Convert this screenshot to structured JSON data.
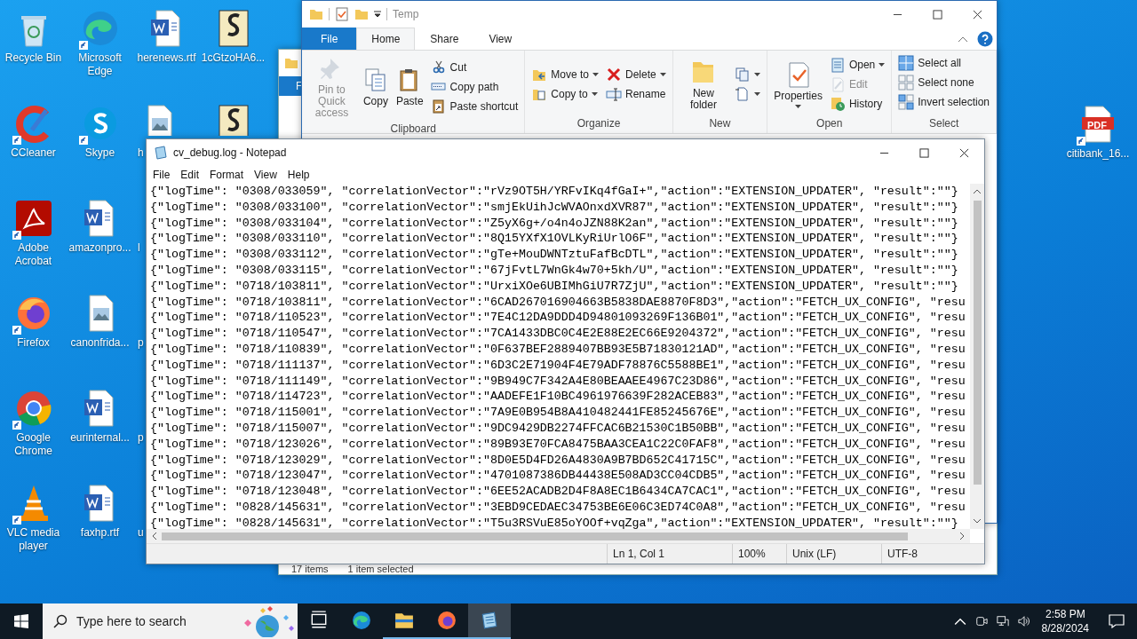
{
  "desktop": {
    "columns": [
      [
        {
          "kind": "recycle",
          "label": "Recycle Bin",
          "shortcut": false
        },
        {
          "kind": "ccleaner",
          "label": "CCleaner",
          "shortcut": true
        },
        {
          "kind": "acrobat",
          "label": "Adobe Acrobat",
          "shortcut": true
        },
        {
          "kind": "firefox",
          "label": "Firefox",
          "shortcut": true
        },
        {
          "kind": "chrome",
          "label": "Google Chrome",
          "shortcut": true
        },
        {
          "kind": "vlc",
          "label": "VLC media player",
          "shortcut": true
        }
      ],
      [
        {
          "kind": "edge",
          "label": "Microsoft Edge",
          "shortcut": true
        },
        {
          "kind": "skype",
          "label": "Skype",
          "shortcut": true
        },
        {
          "kind": "word",
          "label": "amazonpro...",
          "shortcut": false
        },
        {
          "kind": "image",
          "label": "canonfrida...",
          "shortcut": false
        },
        {
          "kind": "word",
          "label": "eurinternal...",
          "shortcut": false
        },
        {
          "kind": "word",
          "label": "faxhp.rtf",
          "shortcut": false
        }
      ],
      [
        {
          "kind": "word",
          "label": "herenews.rtf",
          "shortcut": false
        },
        {
          "kind": "image-cut",
          "label": "h",
          "shortcut": false
        },
        {
          "kind": "hidden",
          "label": "l"
        },
        {
          "kind": "hidden",
          "label": "p"
        },
        {
          "kind": "hidden",
          "label": "p"
        },
        {
          "kind": "hidden",
          "label": "u"
        }
      ],
      [
        {
          "kind": "script",
          "label": "1cGtzoHA6...",
          "shortcut": false
        },
        {
          "kind": "script-cut",
          "shortcut": false
        }
      ]
    ],
    "right_icons": [
      {
        "kind": "pdf",
        "label": "citibank_16...",
        "badge": "PDF",
        "shortcut": true
      }
    ]
  },
  "back_window": {
    "tab": "F",
    "status": [
      "17 items",
      "1 item selected"
    ]
  },
  "explorer": {
    "title": "Temp",
    "tabs": [
      {
        "label": "File",
        "kind": "file",
        "selected": false
      },
      {
        "label": "Home",
        "kind": "tab",
        "selected": true
      },
      {
        "label": "Share",
        "kind": "tab",
        "selected": false
      },
      {
        "label": "View",
        "kind": "tab",
        "selected": false
      }
    ],
    "groups": [
      {
        "name": "Clipboard",
        "columns": [
          [
            {
              "label": "Pin to Quick access",
              "kind": "pin",
              "disabled": true,
              "dropdown": false
            }
          ],
          [
            {
              "label": "Copy",
              "kind": "copy",
              "disabled": false,
              "dropdown": false
            }
          ],
          [
            {
              "label": "Paste",
              "kind": "paste",
              "disabled": false,
              "dropdown": false
            }
          ],
          [
            {
              "label": "Cut",
              "kind": "cut",
              "disabled": false,
              "dropdown": false
            },
            {
              "label": "Copy path",
              "kind": "copypath",
              "disabled": false,
              "dropdown": false
            },
            {
              "label": "Paste shortcut",
              "kind": "pasteshortcut",
              "disabled": false,
              "dropdown": false
            }
          ]
        ]
      },
      {
        "name": "Organize",
        "columns": [
          [
            {
              "label": "Move to",
              "kind": "move",
              "disabled": false,
              "dropdown": true
            },
            {
              "label": "Copy to",
              "kind": "copyto",
              "disabled": false,
              "dropdown": true
            }
          ],
          [
            {
              "label": "Delete",
              "kind": "delete",
              "disabled": false,
              "dropdown": true
            },
            {
              "label": "Rename",
              "kind": "rename",
              "disabled": false,
              "dropdown": false
            }
          ]
        ]
      },
      {
        "name": "New",
        "columns": [
          [
            {
              "label": "New folder",
              "kind": "folder",
              "disabled": false,
              "dropdown": false
            }
          ],
          [
            {
              "kind": "newitem",
              "disabled": false,
              "dropdown": true
            },
            {
              "kind": "easyaccess",
              "disabled": false,
              "dropdown": true
            }
          ]
        ]
      },
      {
        "name": "Open",
        "columns": [
          [
            {
              "label": "Properties",
              "kind": "properties",
              "disabled": false,
              "dropdown": true
            }
          ],
          [
            {
              "label": "Open",
              "kind": "open",
              "disabled": false,
              "dropdown": true
            },
            {
              "label": "Edit",
              "kind": "edit",
              "disabled": true,
              "dropdown": false
            },
            {
              "label": "History",
              "kind": "history",
              "disabled": false,
              "dropdown": false
            }
          ]
        ]
      },
      {
        "name": "Select",
        "columns": [
          [
            {
              "label": "Select all",
              "kind": "selall",
              "disabled": false,
              "dropdown": false
            },
            {
              "label": "Select none",
              "kind": "selnone",
              "disabled": false,
              "dropdown": false
            },
            {
              "label": "Invert selection",
              "kind": "invert",
              "disabled": false,
              "dropdown": false
            }
          ]
        ]
      }
    ]
  },
  "notepad": {
    "title": "cv_debug.log - Notepad",
    "menu": [
      "File",
      "Edit",
      "Format",
      "View",
      "Help"
    ],
    "lines": [
      "{\"logTime\": \"0308/033059\", \"correlationVector\":\"rVz9OT5H/YRFvIKq4fGaI+\",\"action\":\"EXTENSION_UPDATER\", \"result\":\"\"}",
      "{\"logTime\": \"0308/033100\", \"correlationVector\":\"smjEkUihJcWVAOnxdXVR87\",\"action\":\"EXTENSION_UPDATER\", \"result\":\"\"}",
      "{\"logTime\": \"0308/033104\", \"correlationVector\":\"Z5yX6g+/o4n4oJZN88K2an\",\"action\":\"EXTENSION_UPDATER\", \"result\":\"\"}",
      "{\"logTime\": \"0308/033110\", \"correlationVector\":\"8Q15YXfX1OVLKyRiUrlO6F\",\"action\":\"EXTENSION_UPDATER\", \"result\":\"\"}",
      "{\"logTime\": \"0308/033112\", \"correlationVector\":\"gTe+MouDWNTztuFafBcDTL\",\"action\":\"EXTENSION_UPDATER\", \"result\":\"\"}",
      "{\"logTime\": \"0308/033115\", \"correlationVector\":\"67jFvtL7WnGk4w70+5kh/U\",\"action\":\"EXTENSION_UPDATER\", \"result\":\"\"}",
      "{\"logTime\": \"0718/103811\", \"correlationVector\":\"UrxiXOe6UBIMhGiU7R7ZjU\",\"action\":\"EXTENSION_UPDATER\", \"result\":\"\"}",
      "{\"logTime\": \"0718/103811\", \"correlationVector\":\"6CAD267016904663B5838DAE8870F8D3\",\"action\":\"FETCH_UX_CONFIG\", \"resu",
      "{\"logTime\": \"0718/110523\", \"correlationVector\":\"7E4C12DA9DDD4D94801093269F136B01\",\"action\":\"FETCH_UX_CONFIG\", \"resu",
      "{\"logTime\": \"0718/110547\", \"correlationVector\":\"7CA1433DBC0C4E2E88E2EC66E9204372\",\"action\":\"FETCH_UX_CONFIG\", \"resu",
      "{\"logTime\": \"0718/110839\", \"correlationVector\":\"0F637BEF2889407BB93E5B71830121AD\",\"action\":\"FETCH_UX_CONFIG\", \"resu",
      "{\"logTime\": \"0718/111137\", \"correlationVector\":\"6D3C2E71904F4E79ADF78876C5588BE1\",\"action\":\"FETCH_UX_CONFIG\", \"resu",
      "{\"logTime\": \"0718/111149\", \"correlationVector\":\"9B949C7F342A4E80BEAAEE4967C23D86\",\"action\":\"FETCH_UX_CONFIG\", \"resu",
      "{\"logTime\": \"0718/114723\", \"correlationVector\":\"AADEFE1F10BC4961976639F282ACEB83\",\"action\":\"FETCH_UX_CONFIG\", \"resu",
      "{\"logTime\": \"0718/115001\", \"correlationVector\":\"7A9E0B954B8A410482441FE85245676E\",\"action\":\"FETCH_UX_CONFIG\", \"resu",
      "{\"logTime\": \"0718/115007\", \"correlationVector\":\"9DC9429DB2274FFCAC6B21530C1B50BB\",\"action\":\"FETCH_UX_CONFIG\", \"resu",
      "{\"logTime\": \"0718/123026\", \"correlationVector\":\"89B93E70FCA8475BAA3CEA1C22C0FAF8\",\"action\":\"FETCH_UX_CONFIG\", \"resu",
      "{\"logTime\": \"0718/123029\", \"correlationVector\":\"8D0E5D4FD26A4830A9B7BD652C41715C\",\"action\":\"FETCH_UX_CONFIG\", \"resu",
      "{\"logTime\": \"0718/123047\", \"correlationVector\":\"4701087386DB44438E508AD3CC04CDB5\",\"action\":\"FETCH_UX_CONFIG\", \"resu",
      "{\"logTime\": \"0718/123048\", \"correlationVector\":\"6EE52ACADB2D4F8A8EC1B6434CA7CAC1\",\"action\":\"FETCH_UX_CONFIG\", \"resu",
      "{\"logTime\": \"0828/145631\", \"correlationVector\":\"3EBD9CEDAEC34753BE6E06C3ED74C0A8\",\"action\":\"FETCH_UX_CONFIG\", \"resu",
      "{\"logTime\": \"0828/145631\", \"correlationVector\":\"T5u3RSVuE85oYOOf+vqZga\",\"action\":\"EXTENSION_UPDATER\", \"result\":\"\"}"
    ],
    "status": [
      "Ln 1, Col 1",
      "100%",
      "Unix (LF)",
      "UTF-8"
    ]
  },
  "taskbar": {
    "search": {
      "placeholder": "Type here to search"
    },
    "apps": [
      {
        "kind": "taskview",
        "running": false,
        "selected": false
      },
      {
        "kind": "edge",
        "running": false,
        "selected": false
      },
      {
        "kind": "explorer",
        "running": true,
        "selected": false
      },
      {
        "kind": "firefox",
        "running": true,
        "selected": false
      },
      {
        "kind": "notepad",
        "running": true,
        "selected": true
      }
    ],
    "time": "2:58 PM",
    "date": "8/28/2024"
  }
}
